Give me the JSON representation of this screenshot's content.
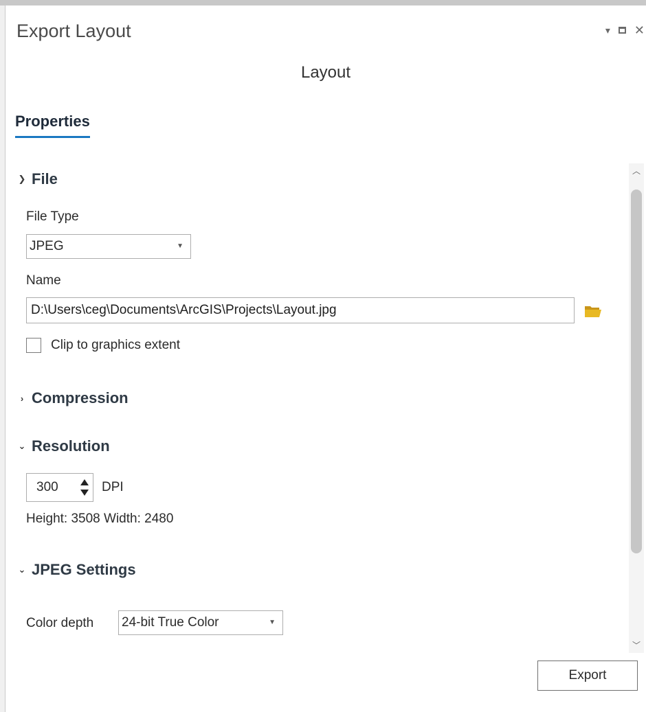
{
  "window": {
    "title": "Export Layout",
    "controls": [
      "dropdown-icon",
      "maximize-icon",
      "close-icon"
    ]
  },
  "layout_name": "Layout",
  "tabs": [
    {
      "label": "Properties",
      "selected": true
    }
  ],
  "file_section": {
    "header": "File",
    "expanded": true,
    "file_type_label": "File Type",
    "file_type_value": "JPEG",
    "name_label": "Name",
    "name_value": "D:\\Users\\ceg\\Documents\\ArcGIS\\Projects\\Layout.jpg",
    "clip_label": "Clip to graphics extent",
    "clip_checked": false
  },
  "compression_section": {
    "header": "Compression",
    "expanded": false
  },
  "resolution_section": {
    "header": "Resolution",
    "expanded": true,
    "dpi_value": "300",
    "dpi_unit": "DPI",
    "dimensions_text": "Height: 3508 Width: 2480"
  },
  "jpeg_section": {
    "header": "JPEG Settings",
    "expanded": true,
    "color_depth_label": "Color depth",
    "color_depth_value": "24-bit True Color"
  },
  "export_button_label": "Export",
  "colors": {
    "tab_underline": "#1a78c2",
    "folder_icon": "#e8b923",
    "scrollbar_thumb": "#c6c6c6"
  }
}
